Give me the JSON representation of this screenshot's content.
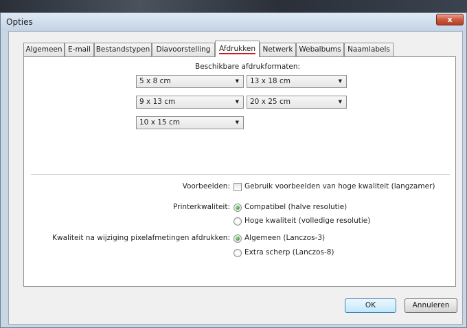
{
  "window": {
    "title": "Opties",
    "close_glyph": "x"
  },
  "tabs": [
    {
      "label": "Algemeen"
    },
    {
      "label": "E-mail"
    },
    {
      "label": "Bestandstypen"
    },
    {
      "label": "Diavoorstelling"
    },
    {
      "label": "Afdrukken",
      "active": true
    },
    {
      "label": "Netwerk"
    },
    {
      "label": "Webalbums"
    },
    {
      "label": "Naamlabels"
    }
  ],
  "formats": {
    "heading": "Beschikbare afdrukformaten:",
    "selects": [
      "5 x 8 cm",
      "13 x 18 cm",
      "9 x 13 cm",
      "20 x 25 cm",
      "10 x 15 cm"
    ]
  },
  "previews": {
    "label": "Voorbeelden:",
    "checkbox_label": "Gebruik voorbeelden van hoge kwaliteit (langzamer)",
    "checked": false
  },
  "printer_quality": {
    "label": "Printerkwaliteit:",
    "options": [
      "Compatibel (halve resolutie)",
      "Hoge kwaliteit (volledige resolutie)"
    ],
    "selected": 0
  },
  "resize_quality": {
    "label": "Kwaliteit na wijziging pixelafmetingen afdrukken:",
    "options": [
      "Algemeen (Lanczos-3)",
      "Extra scherp (Lanczos-8)"
    ],
    "selected": 0
  },
  "buttons": {
    "ok": "OK",
    "cancel": "Annuleren"
  },
  "colors": {
    "active_tab_underline": "#d11a1a",
    "close_button": "#c8452b"
  }
}
